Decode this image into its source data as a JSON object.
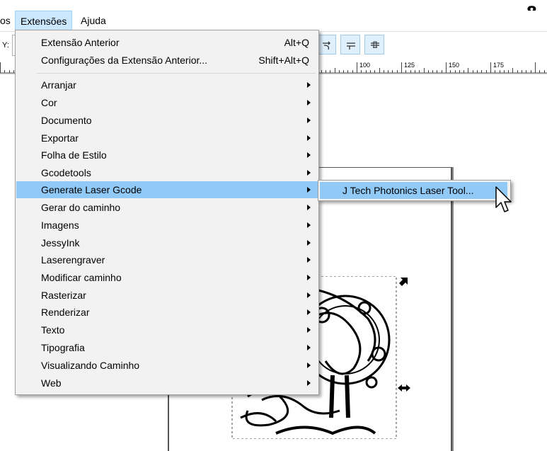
{
  "page_number": "8",
  "menubar": {
    "items": [
      {
        "label": "os",
        "id": "partial"
      },
      {
        "label": "Extensões",
        "id": "extensoes"
      },
      {
        "label": "Ajuda",
        "id": "ajuda"
      }
    ]
  },
  "toolbar": {
    "y_label": "Y:",
    "buttons": [
      "node-smooth-icon",
      "node-symmetric-icon",
      "node-auto-icon"
    ]
  },
  "ruler": {
    "labels": [
      "100",
      "125",
      "150",
      "175"
    ]
  },
  "menu": {
    "top_items": [
      {
        "label": "Extensão Anterior",
        "accel": "Alt+Q"
      },
      {
        "label": "Configurações da Extensão Anterior...",
        "accel": "Shift+Alt+Q"
      }
    ],
    "items": [
      {
        "label": "Arranjar"
      },
      {
        "label": "Cor"
      },
      {
        "label": "Documento"
      },
      {
        "label": "Exportar"
      },
      {
        "label": "Folha de Estilo"
      },
      {
        "label": "Gcodetools"
      },
      {
        "label": "Generate Laser Gcode",
        "highlighted": true
      },
      {
        "label": "Gerar do caminho"
      },
      {
        "label": "Imagens"
      },
      {
        "label": "JessyInk"
      },
      {
        "label": "Laserengraver"
      },
      {
        "label": "Modificar caminho"
      },
      {
        "label": "Rasterizar"
      },
      {
        "label": "Renderizar"
      },
      {
        "label": "Texto"
      },
      {
        "label": "Tipografia"
      },
      {
        "label": "Visualizando Caminho"
      },
      {
        "label": "Web"
      }
    ]
  },
  "submenu": {
    "item": "J Tech Photonics Laser Tool..."
  },
  "colors": {
    "highlight": "#91c9f7",
    "menu_bg": "#f2f2f2",
    "menubar_active": "#cce8ff"
  }
}
